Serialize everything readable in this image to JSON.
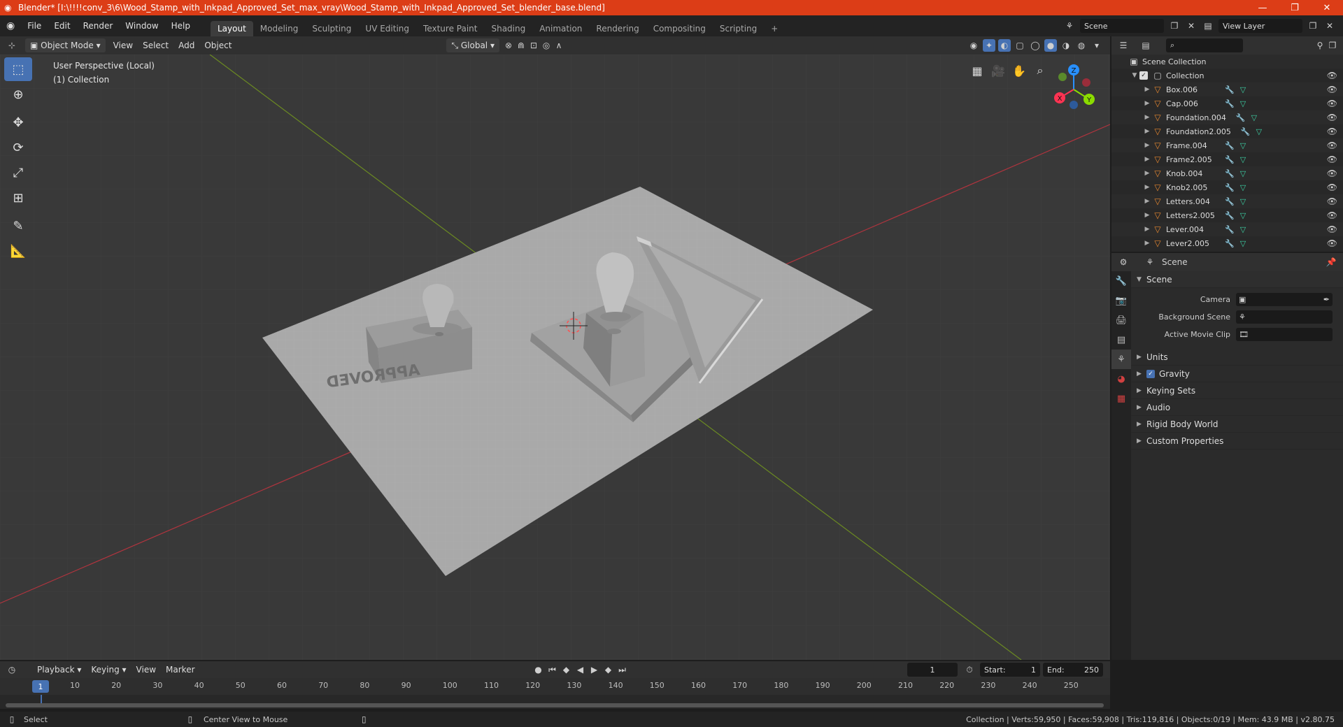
{
  "window": {
    "title": "Blender* [I:\\!!!!conv_3\\6\\Wood_Stamp_with_Inkpad_Approved_Set_max_vray\\Wood_Stamp_with_Inkpad_Approved_Set_blender_base.blend]",
    "minimize": "—",
    "maximize": "❐",
    "close": "✕"
  },
  "menubar": {
    "items": [
      "File",
      "Edit",
      "Render",
      "Window",
      "Help"
    ],
    "workspaces": [
      "Layout",
      "Modeling",
      "Sculpting",
      "UV Editing",
      "Texture Paint",
      "Shading",
      "Animation",
      "Rendering",
      "Compositing",
      "Scripting"
    ],
    "active_workspace": "Layout",
    "add_tab": "+",
    "scene_label": "Scene",
    "view_layer_label": "View Layer"
  },
  "viewport_header": {
    "mode": "Object Mode",
    "menus": [
      "View",
      "Select",
      "Add",
      "Object"
    ],
    "transform_orientation": "Global"
  },
  "viewport": {
    "perspective_label": "User Perspective (Local)",
    "collection_label": "(1) Collection",
    "gizmo_axes": [
      "X",
      "Y",
      "Z"
    ]
  },
  "outliner": {
    "root": "Scene Collection",
    "collection": "Collection",
    "objects": [
      "Box.006",
      "Cap.006",
      "Foundation.004",
      "Foundation2.005",
      "Frame.004",
      "Frame2.005",
      "Knob.004",
      "Knob2.005",
      "Letters.004",
      "Letters2.005",
      "Lever.004",
      "Lever2.005"
    ]
  },
  "properties": {
    "header_title": "Scene",
    "section_scene": "Scene",
    "camera_label": "Camera",
    "background_scene_label": "Background Scene",
    "active_movie_clip_label": "Active Movie Clip",
    "collapsed_sections": [
      "Units",
      "Gravity",
      "Keying Sets",
      "Audio",
      "Rigid Body World",
      "Custom Properties"
    ]
  },
  "timeline": {
    "menus": [
      "Playback",
      "Keying",
      "View",
      "Marker"
    ],
    "current_frame": "1",
    "start_label": "Start:",
    "start_value": "1",
    "end_label": "End:",
    "end_value": "250",
    "ticks": [
      "10",
      "20",
      "30",
      "40",
      "50",
      "60",
      "70",
      "80",
      "90",
      "100",
      "110",
      "120",
      "130",
      "140",
      "150",
      "160",
      "170",
      "180",
      "190",
      "200",
      "210",
      "220",
      "230",
      "240",
      "250"
    ]
  },
  "statusbar": {
    "left_action": "Select",
    "middle_action": "Center View to Mouse",
    "stats": "Collection | Verts:59,950 | Faces:59,908 | Tris:119,816 | Objects:0/19 | Mem: 43.9 MB | v2.80.75"
  },
  "colors": {
    "title_bar": "#dc3d17",
    "accent": "#4772b3",
    "object_icon": "#e6872f",
    "mesh_icon": "#3cd1a4",
    "x_axis": "#ff3352",
    "y_axis": "#8bdc00",
    "z_axis": "#2890ff"
  }
}
